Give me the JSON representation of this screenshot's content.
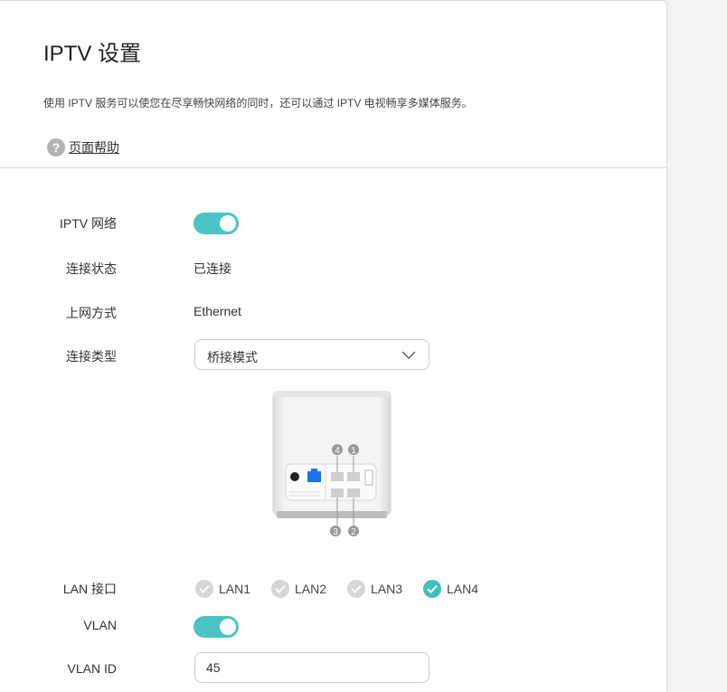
{
  "header": {
    "title": "IPTV 设置",
    "description": "使用 IPTV 服务可以使您在尽享畅快网络的同时，还可以通过 IPTV 电视畅享多媒体服务。",
    "help_label": "页面帮助"
  },
  "form": {
    "iptv_network_label": "IPTV 网络",
    "iptv_network_on": true,
    "status_label": "连接状态",
    "status_value": "已连接",
    "wan_mode_label": "上网方式",
    "wan_mode_value": "Ethernet",
    "conn_type_label": "连接类型",
    "conn_type_value": "桥接模式",
    "lan_port_label": "LAN 接口",
    "lan_ports": [
      {
        "label": "LAN1",
        "checked": false
      },
      {
        "label": "LAN2",
        "checked": false
      },
      {
        "label": "LAN3",
        "checked": false
      },
      {
        "label": "LAN4",
        "checked": true
      }
    ],
    "vlan_label": "VLAN",
    "vlan_on": true,
    "vlan_id_label": "VLAN ID",
    "vlan_id_value": "45"
  },
  "device_ports": {
    "top_numbers": [
      "4",
      "1"
    ],
    "bottom_numbers": [
      "3",
      "2"
    ]
  },
  "colors": {
    "accent": "#4ac4c5",
    "check_on": "#40bfc1",
    "check_off": "#d6d6d6",
    "wan_port": "#1a73e8"
  }
}
